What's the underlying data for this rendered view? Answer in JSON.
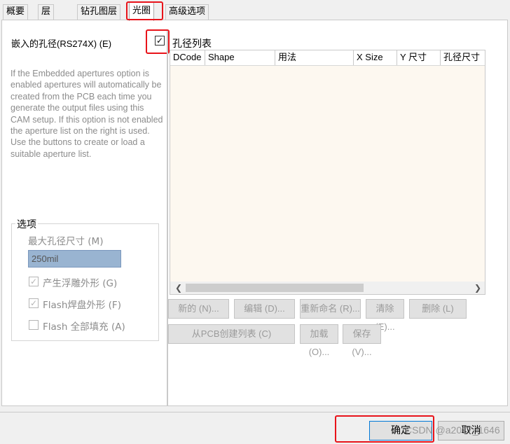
{
  "tabs": [
    "概要",
    "层",
    "钻孔图层",
    "光圈",
    "高级选项"
  ],
  "embedded_checkbox_label": "嵌入的孔径(RS274X) (E)",
  "embedded_checked": true,
  "help_text": "If the Embedded apertures option is enabled apertures will automatically be created from the PCB each time you generate the output files using this CAM setup. If this option is not enabled the aperture list on the right is used. Use the buttons to create or load a suitable aperture list.",
  "options": {
    "title": "选项",
    "max_size_label": "最大孔径尺寸 (M)",
    "max_size_value": "250mil",
    "gen_relief_label": "产生浮雕外形 (G)",
    "gen_relief_checked": true,
    "flash_pad_label": "Flash焊盘外形 (F)",
    "flash_pad_checked": true,
    "flash_fill_label": "Flash 全部填充 (A)",
    "flash_fill_checked": false
  },
  "aperture_list": {
    "title": "孔径列表",
    "columns": [
      "DCode",
      "Shape",
      "用法",
      "X Size",
      "Y 尺寸",
      "孔径尺寸"
    ],
    "rows": []
  },
  "buttons": {
    "new": "新的 (N)...",
    "edit": "编辑 (D)...",
    "rename": "重新命名 (R)...",
    "clear": "清除 (E)...",
    "delete": "删除 (L)",
    "create_from_pcb": "从PCB创建列表 (C)",
    "load": "加载 (O)...",
    "save": "保存 (V)..."
  },
  "footer": {
    "ok": "确定",
    "cancel": "取消",
    "watermark": "CSDN @a2017_1646"
  }
}
